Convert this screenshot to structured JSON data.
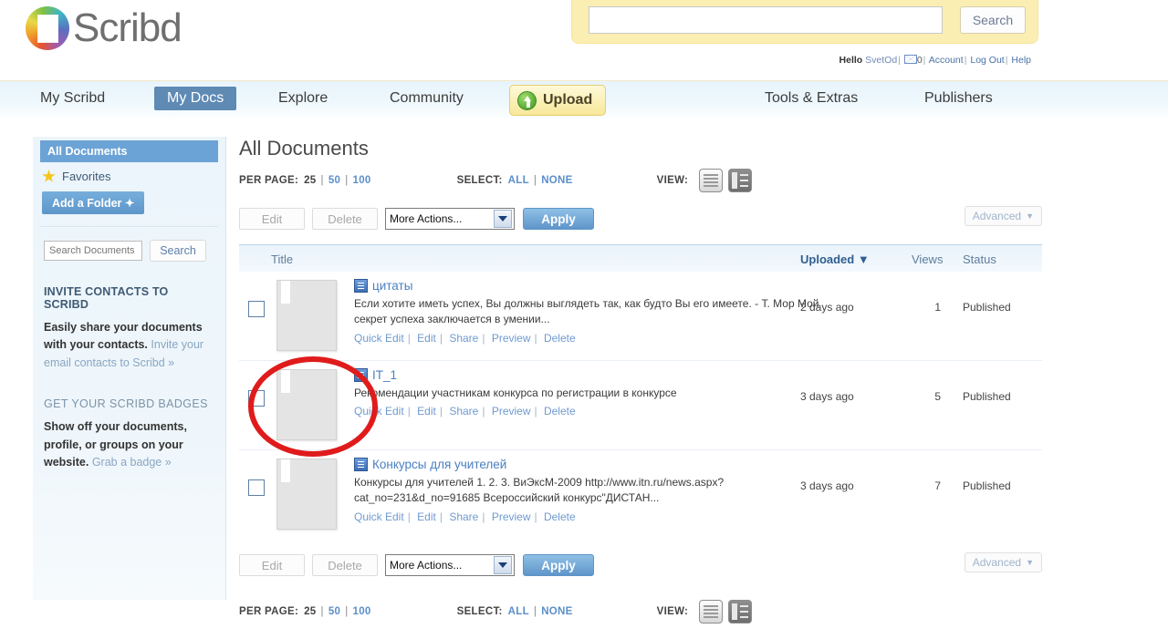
{
  "brand": {
    "name": "Scribd"
  },
  "search": {
    "value": "",
    "placeholder": "",
    "button": "Search"
  },
  "account": {
    "hello": "Hello",
    "username": "SvetOd",
    "mail_count": "0",
    "account": "Account",
    "logout": "Log Out",
    "help": "Help"
  },
  "nav": {
    "items": [
      {
        "label": "My Scribd",
        "active": false
      },
      {
        "label": "My Docs",
        "active": true
      },
      {
        "label": "Explore",
        "active": false
      },
      {
        "label": "Community",
        "active": false
      },
      {
        "label": "Tools & Extras",
        "active": false
      },
      {
        "label": "Publishers",
        "active": false
      }
    ],
    "upload": "Upload"
  },
  "sidebar": {
    "all_documents": "All Documents",
    "favorites": "Favorites",
    "add_folder": "Add a Folder  ✦",
    "search_placeholder": "Search Documents",
    "search_button": "Search",
    "promo1": {
      "title": "INVITE CONTACTS TO SCRIBD",
      "body": "Easily share your documents with your contacts.",
      "link": "Invite your email contacts to Scribd »"
    },
    "promo2": {
      "title": "GET YOUR SCRIBD BADGES",
      "body": "Show off your documents, profile, or groups on your website.",
      "link": "Grab a badge »"
    }
  },
  "main": {
    "title": "All Documents",
    "per_page_label": "PER PAGE:",
    "per_page": [
      "25",
      "50",
      "100"
    ],
    "select_label": "SELECT:",
    "select_all": "ALL",
    "select_none": "NONE",
    "view_label": "VIEW:",
    "toolbar": {
      "edit": "Edit",
      "delete": "Delete",
      "more_actions": "More Actions...",
      "apply": "Apply",
      "advanced": "Advanced"
    },
    "columns": {
      "title": "Title",
      "uploaded": "Uploaded",
      "views": "Views",
      "status": "Status"
    },
    "row_links": [
      "Quick Edit",
      "Edit",
      "Share",
      "Preview",
      "Delete"
    ],
    "documents": [
      {
        "title": "цитаты",
        "description": "Если хотите иметь успех, Вы должны выглядеть так, как будто Вы его имеете. - Т. Мор Мой секрет успеха заключается в умении...",
        "uploaded": "2 days ago",
        "views": "1",
        "status": "Published"
      },
      {
        "title": "IT_1",
        "description": "Рекомендации участникам конкурса по регистрации в конкурсе",
        "uploaded": "3 days ago",
        "views": "5",
        "status": "Published"
      },
      {
        "title": "Конкурсы для учителей",
        "description": "Конкурсы для учителей 1. 2. 3. ВиЭксМ-2009 http://www.itn.ru/news.aspx?cat_no=231&d_no=91685 Всероссийский конкурс\"ДИСТАН...",
        "uploaded": "3 days ago",
        "views": "7",
        "status": "Published"
      }
    ]
  },
  "annotation": {
    "shape": "red-ellipse-highlight",
    "color": "#e01b1b"
  }
}
